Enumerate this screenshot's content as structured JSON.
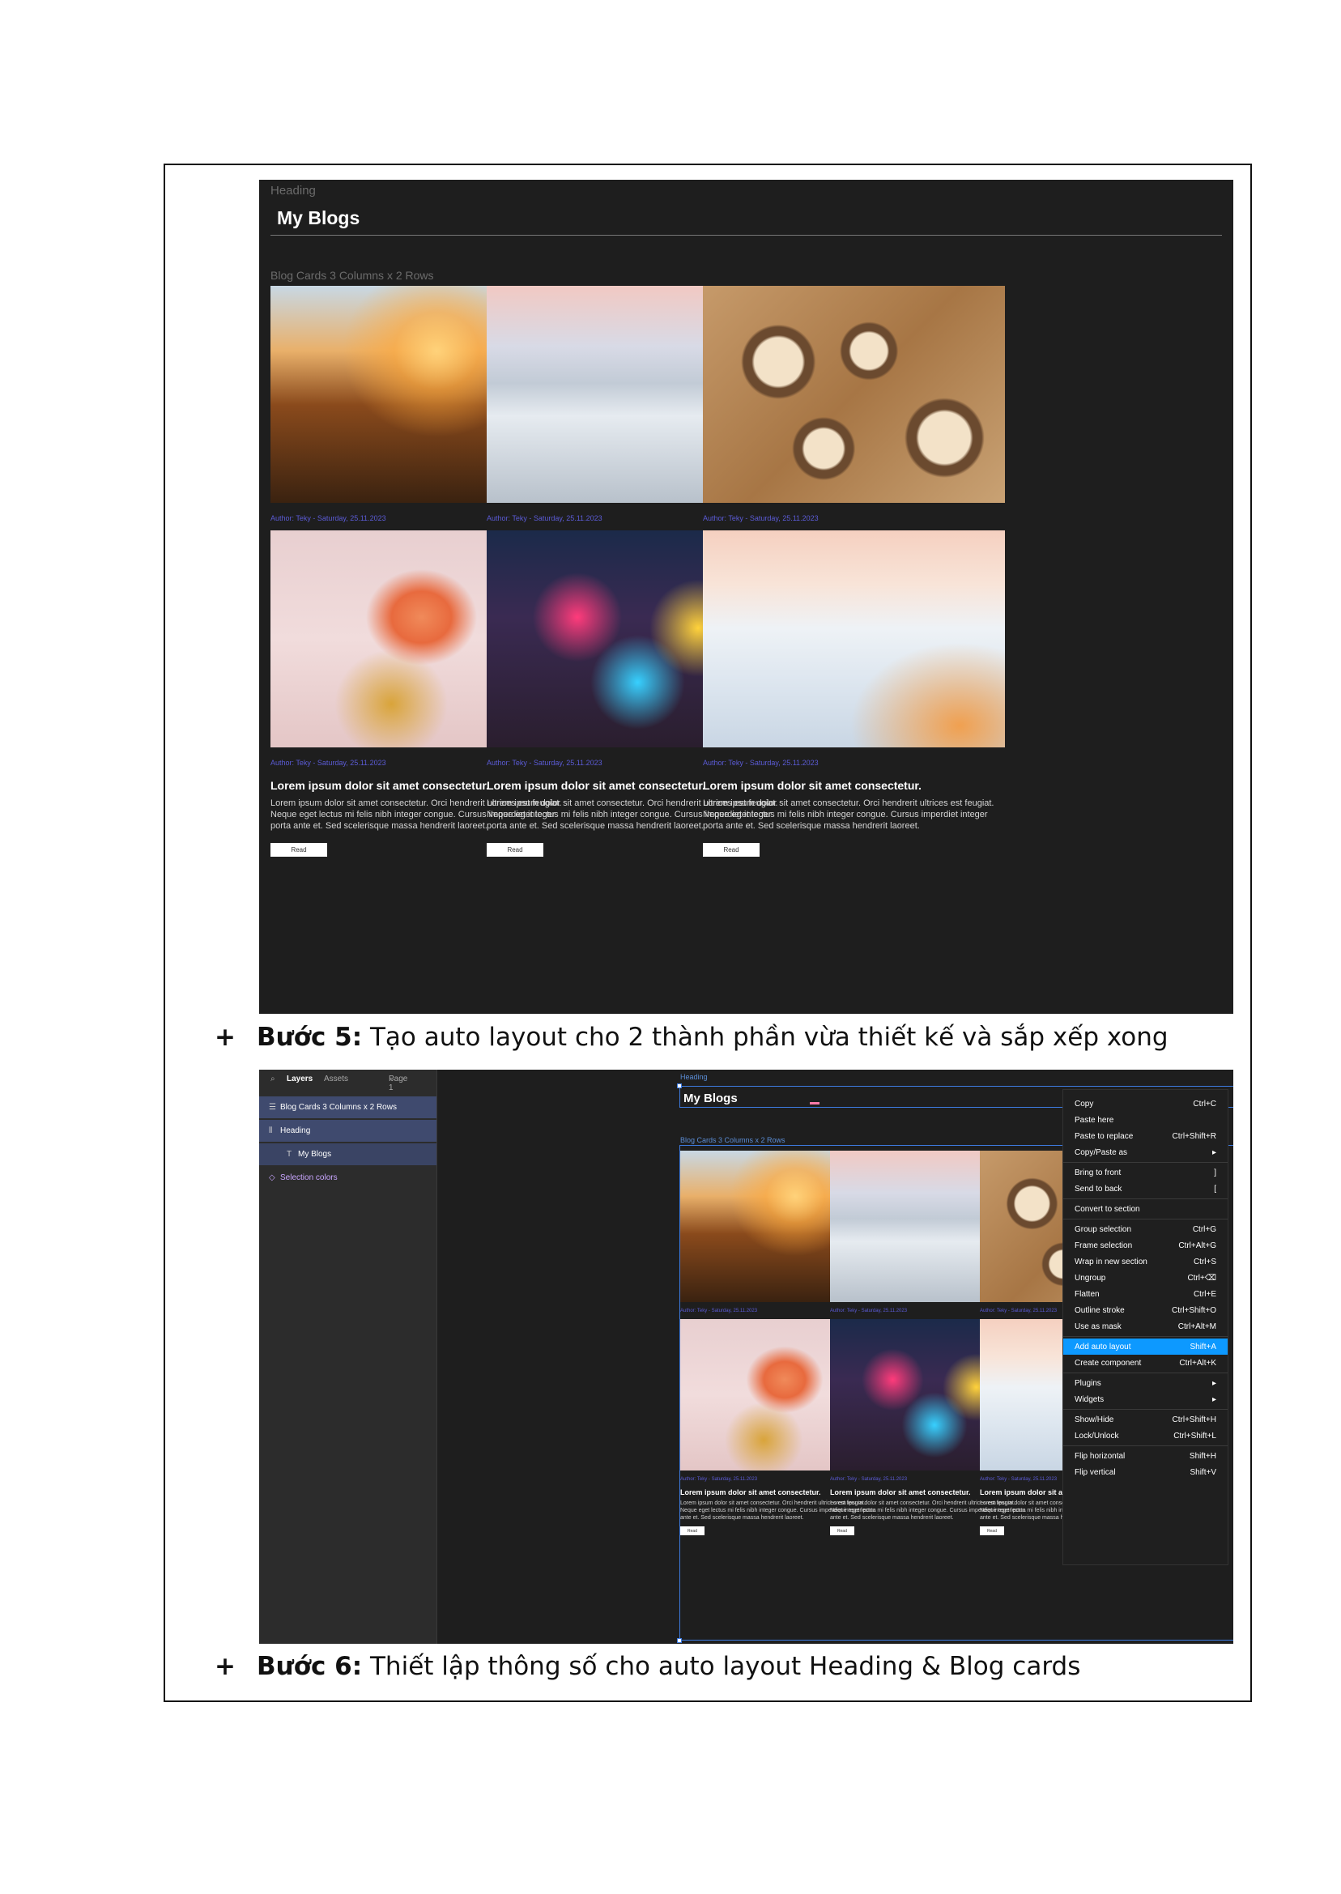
{
  "shot1": {
    "heading_tag": "Heading",
    "title": "My Blogs",
    "grid_tag": "Blog Cards 3 Columns x 2 Rows",
    "cards": [
      {
        "image": "mountain-sunset",
        "meta": "Author: Teky - Saturday, 25.11.2023",
        "title": "Lorem ipsum dolor sit amet consectetur.",
        "body": "Lorem ipsum dolor sit amet consectetur. Orci hendrerit ultrices est feugiat. Neque eget lectus mi felis nibh integer congue. Cursus imperdiet integer porta ante et. Sed scelerisque massa hendrerit laoreet.",
        "button": "Read"
      },
      {
        "image": "snow-forest",
        "meta": "Author: Teky - Saturday, 25.11.2023",
        "title": "Lorem ipsum dolor sit amet consectetur.",
        "body": "Lorem ipsum dolor sit amet consectetur. Orci hendrerit ultrices est feugiat. Neque eget lectus mi felis nibh integer congue. Cursus imperdiet integer porta ante et. Sed scelerisque massa hendrerit laoreet.",
        "button": "Read"
      },
      {
        "image": "coffee-table",
        "meta": "Author: Teky - Saturday, 25.11.2023",
        "title": "Lorem ipsum dolor sit amet consectetur.",
        "body": "Lorem ipsum dolor sit amet consectetur. Orci hendrerit ultrices est feugiat. Neque eget lectus mi felis nibh integer congue. Cursus imperdiet integer porta ante et. Sed scelerisque massa hendrerit laoreet.",
        "button": "Read"
      },
      {
        "image": "cocktail-new-year",
        "meta": "Author: Teky - Saturday, 25.11.2023",
        "title": "Lorem ipsum dolor sit amet consectetur.",
        "body": "Lorem ipsum dolor sit amet consectetur. Orci hendrerit ultrices est feugiat. Neque eget lectus mi felis nibh integer congue. Cursus imperdiet integer porta ante et. Sed scelerisque massa hendrerit laoreet.",
        "button": "Read"
      },
      {
        "image": "city-night",
        "meta": "Author: Teky - Saturday, 25.11.2023",
        "title": "Lorem ipsum dolor sit amet consectetur.",
        "body": "Lorem ipsum dolor sit amet consectetur. Orci hendrerit ultrices est feugiat. Neque eget lectus mi felis nibh integer congue. Cursus imperdiet integer porta ante et. Sed scelerisque massa hendrerit laoreet.",
        "button": "Read"
      },
      {
        "image": "sea-of-clouds",
        "meta": "Author: Teky - Saturday, 25.11.2023",
        "title": "Lorem ipsum dolor sit amet consectetur.",
        "body": "Lorem ipsum dolor sit amet consectetur. Orci hendrerit ultrices est feugiat. Neque eget lectus mi felis nibh integer congue. Cursus imperdiet integer porta ante et. Sed scelerisque massa hendrerit laoreet.",
        "button": "Read"
      }
    ]
  },
  "step5": {
    "plus": "+",
    "label": "Bước 5:",
    "text": " Tạo auto layout cho 2 thành phần vừa thiết kế và sắp xếp xong"
  },
  "step6": {
    "plus": "+",
    "label": "Bước 6:",
    "text": " Thiết lập thông số cho auto layout Heading & Blog cards"
  },
  "shot2": {
    "panel": {
      "tabs": [
        "Layers",
        "Assets"
      ],
      "page": "Page 1",
      "layers": [
        {
          "label": "Blog Cards 3 Columns x 2 Rows",
          "icon": "frame-icon"
        },
        {
          "label": "Heading",
          "icon": "autolayout-icon"
        },
        {
          "label": "My Blogs",
          "icon": "text-icon"
        }
      ],
      "selection_colors": "Selection colors"
    },
    "canvas": {
      "heading_tag": "Heading",
      "title": "My Blogs",
      "grid_tag": "Blog Cards 3 Columns x 2 Rows",
      "cards": [
        {
          "image": "mountain-sunset",
          "meta": "Author: Teky - Saturday, 25.11.2023",
          "title": "Lorem ipsum dolor sit amet consectetur.",
          "body": "Lorem ipsum dolor sit amet consectetur. Orci hendrerit ultrices est feugiat. Neque eget lectus mi felis nibh integer congue. Cursus imperdiet integer porta ante et. Sed scelerisque massa hendrerit laoreet.",
          "button": "Read"
        },
        {
          "image": "snow-forest",
          "meta": "Author: Teky - Saturday, 25.11.2023",
          "title": "Lorem ipsum dolor sit amet consectetur.",
          "body": "Lorem ipsum dolor sit amet consectetur. Orci hendrerit ultrices est feugiat. Neque eget lectus mi felis nibh integer congue. Cursus imperdiet integer porta ante et. Sed scelerisque massa hendrerit laoreet.",
          "button": "Read"
        },
        {
          "image": "coffee-table",
          "meta": "Author: Teky - Saturday, 25.11.2023",
          "title": "Lorem ipsum dolor sit amet consectetur.",
          "body": "Lorem ipsum dolor sit amet consectetur. Orci hendrerit ultrices est feugiat. Neque eget lectus mi felis nibh integer congue. Cursus imperdiet integer porta ante et. Sed scelerisque massa hendrerit laoreet.",
          "button": "Read"
        },
        {
          "image": "cocktail-new-year",
          "meta": "Author: Teky - Saturday, 25.11.2023",
          "title": "Lorem ipsum dolor sit amet consectetur.",
          "body": "Lorem ipsum dolor sit amet consectetur. Orci hendrerit ultrices est feugiat. Neque eget lectus mi felis nibh integer congue. Cursus imperdiet integer porta ante et. Sed scelerisque massa hendrerit laoreet.",
          "button": "Read"
        },
        {
          "image": "city-night",
          "meta": "Author: Teky - Saturday, 25.11.2023",
          "title": "Lorem ipsum dolor sit amet consectetur.",
          "body": "Lorem ipsum dolor sit amet consectetur. Orci hendrerit ultrices est feugiat. Neque eget lectus mi felis nibh integer congue. Cursus imperdiet integer porta ante et. Sed scelerisque massa hendrerit laoreet.",
          "button": "Read"
        },
        {
          "image": "sea-of-clouds",
          "meta": "Author: Teky - Saturday, 25.11.2023",
          "title": "Lorem ipsum dolor sit amet consectetur.",
          "body": "Lorem ipsum dolor sit amet consectetur. Orci hendrerit ultrices est feugiat. Neque eget lectus mi felis nibh integer congue. Cursus imperdiet integer porta ante et. Sed scelerisque massa hendrerit laoreet.",
          "button": "Read"
        }
      ]
    },
    "context_menu": {
      "items": [
        {
          "label": "Copy",
          "shortcut": "Ctrl+C"
        },
        {
          "label": "Paste here",
          "shortcut": ""
        },
        {
          "label": "Paste to replace",
          "shortcut": "Ctrl+Shift+R"
        },
        {
          "label": "Copy/Paste as",
          "shortcut": "▸"
        },
        {
          "label": "Bring to front",
          "shortcut": "]"
        },
        {
          "label": "Send to back",
          "shortcut": "["
        },
        {
          "label": "Convert to section",
          "shortcut": ""
        },
        {
          "label": "Group selection",
          "shortcut": "Ctrl+G"
        },
        {
          "label": "Frame selection",
          "shortcut": "Ctrl+Alt+G"
        },
        {
          "label": "Wrap in new section",
          "shortcut": "Ctrl+S"
        },
        {
          "label": "Ungroup",
          "shortcut": "Ctrl+⌫"
        },
        {
          "label": "Flatten",
          "shortcut": "Ctrl+E"
        },
        {
          "label": "Outline stroke",
          "shortcut": "Ctrl+Shift+O"
        },
        {
          "label": "Use as mask",
          "shortcut": "Ctrl+Alt+M"
        },
        {
          "label": "Add auto layout",
          "shortcut": "Shift+A"
        },
        {
          "label": "Create component",
          "shortcut": "Ctrl+Alt+K"
        },
        {
          "label": "Plugins",
          "shortcut": "▸"
        },
        {
          "label": "Widgets",
          "shortcut": "▸"
        },
        {
          "label": "Show/Hide",
          "shortcut": "Ctrl+Shift+H"
        },
        {
          "label": "Lock/Unlock",
          "shortcut": "Ctrl+Shift+L"
        },
        {
          "label": "Flip horizontal",
          "shortcut": "Shift+H"
        },
        {
          "label": "Flip vertical",
          "shortcut": "Shift+V"
        }
      ],
      "active_item": "Add auto layout"
    }
  },
  "colors": {
    "accent": "#0d99ff",
    "selection": "#3d7be0",
    "meta_text": "#5b5bd6",
    "canvas_bg": "#1e1e1e"
  }
}
